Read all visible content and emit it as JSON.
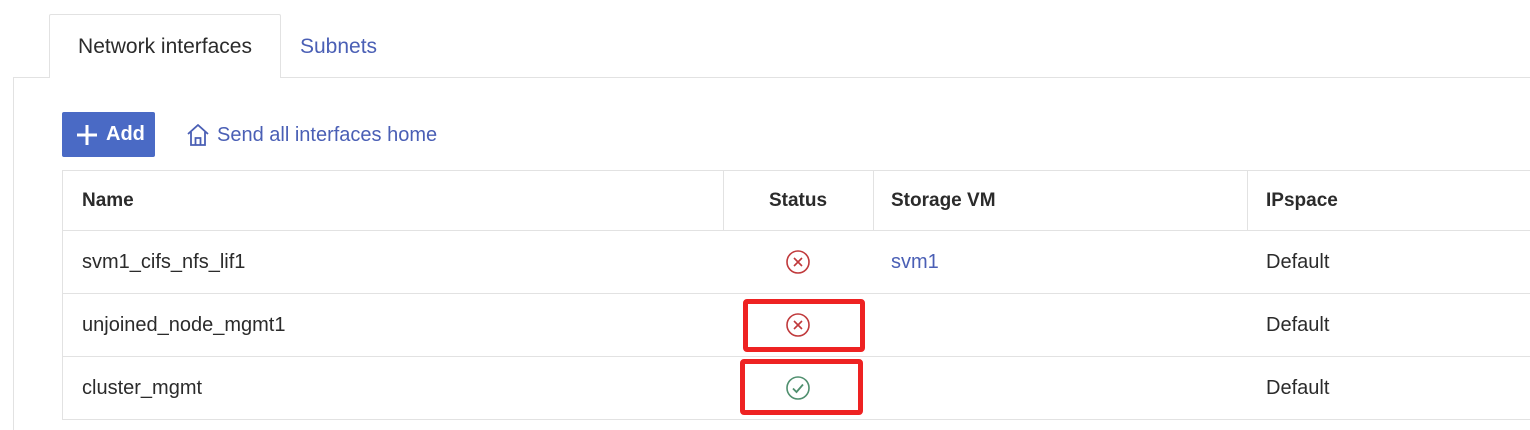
{
  "tabs": [
    {
      "label": "Network interfaces",
      "active": true
    },
    {
      "label": "Subnets",
      "active": false
    }
  ],
  "toolbar": {
    "add_label": "Add",
    "send_home_label": "Send all interfaces home"
  },
  "table": {
    "columns": [
      "Name",
      "Status",
      "Storage VM",
      "IPspace"
    ],
    "rows": [
      {
        "name": "svm1_cifs_nfs_lif1",
        "status": "error-icon",
        "storage_vm": "svm1",
        "ipspace": "Default"
      },
      {
        "name": "unjoined_node_mgmt1",
        "status": "error-icon",
        "storage_vm": "",
        "ipspace": "Default"
      },
      {
        "name": "cluster_mgmt",
        "status": "ok-icon",
        "storage_vm": "",
        "ipspace": "Default"
      }
    ]
  },
  "colors": {
    "accent": "#4a6ac5",
    "link": "#4a5fb5",
    "error": "#c0393b",
    "ok": "#4f8f6e",
    "highlight": "#ee2222"
  }
}
